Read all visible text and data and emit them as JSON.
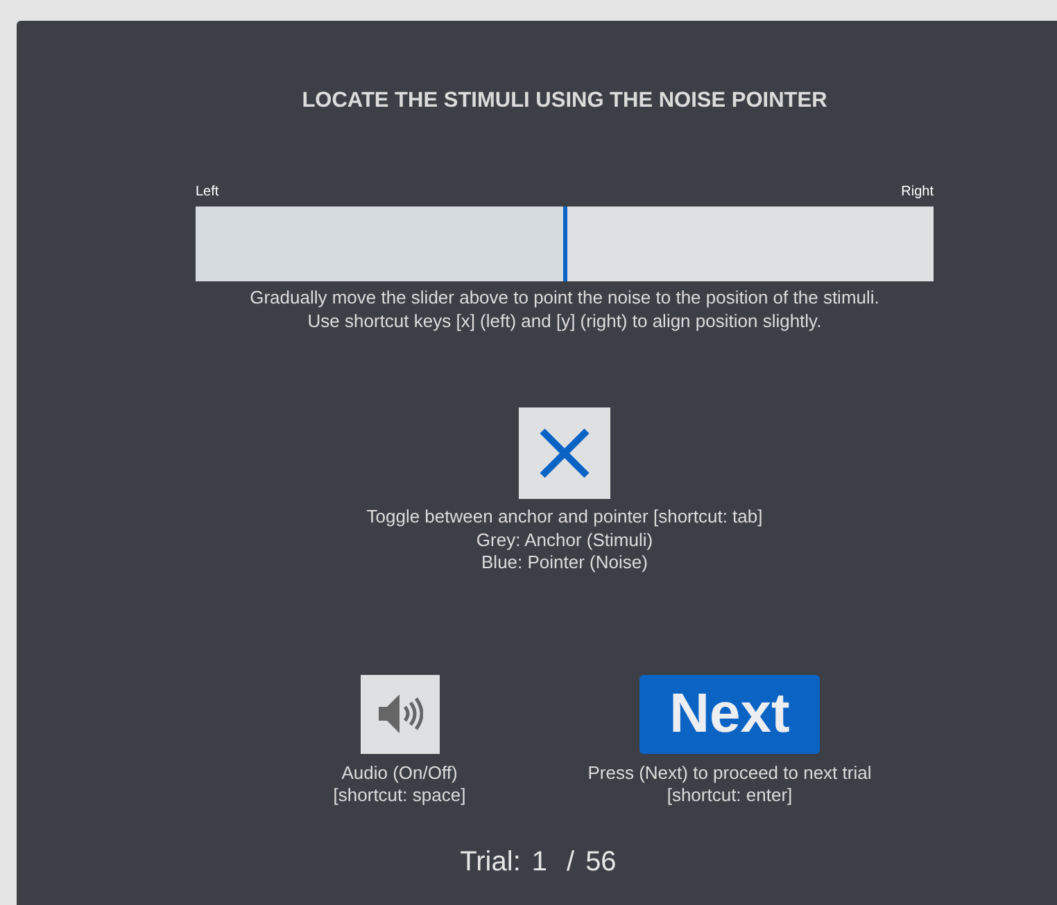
{
  "title": "LOCATE THE STIMULI USING THE NOISE POINTER",
  "slider": {
    "left_label": "Left",
    "right_label": "Right",
    "level": 0.5,
    "hint_lines": [
      "Gradually move the slider above to point the noise to the position of the stimuli.",
      "Use shortcut keys [x] (left) and [y] (right) to align position slightly."
    ]
  },
  "toggle": {
    "pointer_active": true,
    "hint_lines": [
      "Toggle between anchor and pointer [shortcut: tab]",
      "Grey: Anchor (Stimuli)",
      "Blue: Pointer (Noise)"
    ]
  },
  "audio": {
    "on": true,
    "hint_lines": [
      "Audio (On/Off)",
      "[shortcut: space]"
    ]
  },
  "next": {
    "label": "Next",
    "hint_lines": [
      "Press (Next) to proceed to next trial",
      "[shortcut: enter]"
    ]
  },
  "trial": {
    "label": "Trial:",
    "current": "1",
    "separator": "/",
    "total": "56"
  }
}
